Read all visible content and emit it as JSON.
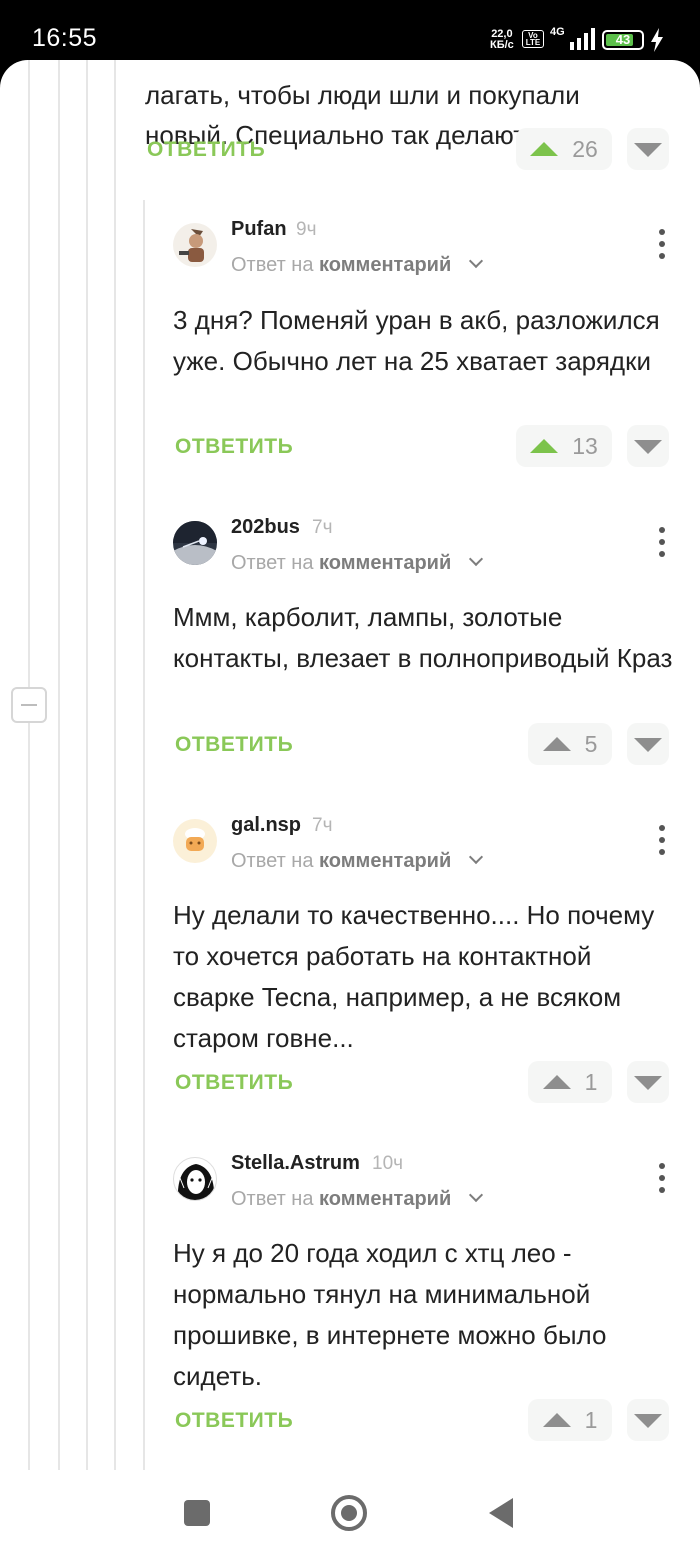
{
  "status_bar": {
    "time": "16:55",
    "speed_value": "22,0",
    "speed_unit": "КБ/с",
    "volte": "Vo LTE",
    "network": "4G",
    "battery_level": "43",
    "icons": [
      "volte-icon",
      "signal-icon",
      "battery-icon",
      "charging-bolt-icon"
    ]
  },
  "thread": {
    "parent_comment_tail": "лагать, чтобы люди шли и покупали новый. Специально так делают",
    "parent_reply_label": "ОТВЕТИТЬ",
    "parent_votes": "26",
    "collapse_icon": "minus-icon"
  },
  "comments": [
    {
      "username": "Pufan",
      "time_ago": "9ч",
      "answer_prefix": "Ответ на",
      "answer_target": "комментарий",
      "text": "3 дня? Поменяй уран в акб, разложился уже. Обычно лет на 25 хватает зарядки",
      "reply_label": "ОТВЕТИТЬ",
      "votes": "13",
      "vote_color": "#7cc34b"
    },
    {
      "username": "202bus",
      "time_ago": "7ч",
      "answer_prefix": "Ответ на",
      "answer_target": "комментарий",
      "text": "Ммм, карболит, лампы, золотые контакты, влезает в полноприводый Краз",
      "reply_label": "ОТВЕТИТЬ",
      "votes": "5",
      "vote_color": "#8e8e8e"
    },
    {
      "username": "gal.nsp",
      "time_ago": "7ч",
      "answer_prefix": "Ответ на",
      "answer_target": "комментарий",
      "text": "Ну делали то качественно.... Но почему то хочется работать на контактной сварке Tecna, например, а не всяком старом говне...",
      "reply_label": "ОТВЕТИТЬ",
      "votes": "1",
      "vote_color": "#8e8e8e"
    },
    {
      "username": "Stella.Astrum",
      "time_ago": "10ч",
      "answer_prefix": "Ответ на",
      "answer_target": "комментарий",
      "text": "Ну я до 20 года ходил с хтц лео - нормально тянул на минимальной прошивке, в интернете можно было сидеть.",
      "reply_label": "ОТВЕТИТЬ",
      "votes": "1",
      "vote_color": "#8e8e8e"
    }
  ],
  "nav_bar": {
    "icons": [
      "recents-square-icon",
      "home-circle-icon",
      "back-triangle-icon"
    ]
  },
  "colors": {
    "accent_green": "#8ac858",
    "upvote_green": "#7cc34b",
    "text_dark": "#222222",
    "meta_grey": "#a8a8a8"
  }
}
